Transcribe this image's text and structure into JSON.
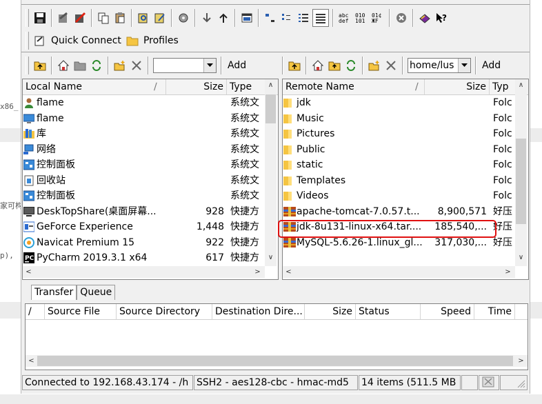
{
  "background_text": {
    "line1": "x86_",
    "line2": "家可构",
    "line3": "p),"
  },
  "quick_connect": {
    "quick_connect_label": "Quick Connect",
    "profiles_label": "Profiles"
  },
  "local_toolbar": {
    "path_value": "",
    "add_label": "Add"
  },
  "remote_toolbar": {
    "path_value": "home/lus",
    "add_label": "Add"
  },
  "local_pane": {
    "columns": {
      "name": "Local Name",
      "size": "Size",
      "type": "Type"
    },
    "rows": [
      {
        "icon": "user-icon",
        "name": "flame",
        "size": "",
        "type": "系统文"
      },
      {
        "icon": "desktop-icon",
        "name": "flame",
        "size": "",
        "type": "系统文"
      },
      {
        "icon": "library-icon",
        "name": "库",
        "size": "",
        "type": "系统文"
      },
      {
        "icon": "network-icon",
        "name": "网络",
        "size": "",
        "type": "系统文"
      },
      {
        "icon": "control-panel-icon",
        "name": "控制面板",
        "size": "",
        "type": "系统文"
      },
      {
        "icon": "recycle-bin-icon",
        "name": "回收站",
        "size": "",
        "type": "系统文"
      },
      {
        "icon": "control-panel-icon",
        "name": "控制面板",
        "size": "",
        "type": "系统文"
      },
      {
        "icon": "monitor-icon",
        "name": "DeskTopShare(桌面屏幕...",
        "size": "928",
        "type": "快捷方"
      },
      {
        "icon": "geforce-icon",
        "name": "GeForce Experience",
        "size": "1,448",
        "type": "快捷方"
      },
      {
        "icon": "navicat-icon",
        "name": "Navicat Premium 15",
        "size": "922",
        "type": "快捷方"
      },
      {
        "icon": "pycharm-icon",
        "name": "PyCharm 2019.3.1 x64",
        "size": "617",
        "type": "快捷方"
      }
    ]
  },
  "remote_pane": {
    "columns": {
      "name": "Remote Name",
      "size": "Size",
      "type": "Typ"
    },
    "rows": [
      {
        "icon": "folder-icon",
        "name": "jdk",
        "size": "",
        "type": "Folc"
      },
      {
        "icon": "folder-icon",
        "name": "Music",
        "size": "",
        "type": "Folc"
      },
      {
        "icon": "folder-icon",
        "name": "Pictures",
        "size": "",
        "type": "Folc"
      },
      {
        "icon": "folder-icon",
        "name": "Public",
        "size": "",
        "type": "Folc"
      },
      {
        "icon": "folder-icon",
        "name": "static",
        "size": "",
        "type": "Folc"
      },
      {
        "icon": "folder-icon",
        "name": "Templates",
        "size": "",
        "type": "Folc"
      },
      {
        "icon": "folder-icon",
        "name": "Videos",
        "size": "",
        "type": "Folc"
      },
      {
        "icon": "archive-icon",
        "name": "apache-tomcat-7.0.57.t...",
        "size": "8,900,571",
        "type": "好压"
      },
      {
        "icon": "archive-icon",
        "name": "jdk-8u131-linux-x64.tar....",
        "size": "185,540,...",
        "type": "好压"
      },
      {
        "icon": "archive-icon",
        "name": "MySQL-5.6.26-1.linux_gl...",
        "size": "317,030,...",
        "type": "好压"
      }
    ]
  },
  "transfer": {
    "tabs": [
      "Transfer",
      "Queue"
    ],
    "columns": [
      "/",
      "Source File",
      "Source Directory",
      "Destination Dire...",
      "Size",
      "Status",
      "Speed",
      "Time"
    ]
  },
  "status_bar": {
    "connection": "Connected to 192.168.43.174 - /h",
    "encryption": "SSH2 - aes128-cbc - hmac-md5",
    "items": "14 items (511.5 MB"
  },
  "colors": {
    "highlight": "#e01010",
    "folder": "#f5c542",
    "selection": "#ffffff"
  }
}
